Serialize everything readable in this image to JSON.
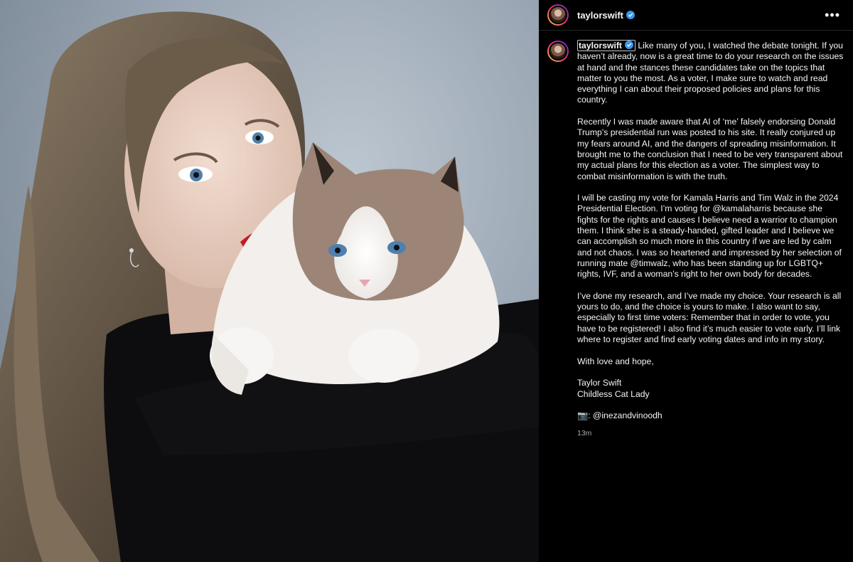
{
  "post": {
    "header": {
      "username": "taylorswift",
      "verified_color": "#3897f0",
      "avatar_icon": "profile-avatar-icon",
      "more_icon": "more-options-icon"
    },
    "caption": {
      "username": "taylorswift",
      "paragraphs": [
        "Like many of you, I watched the debate tonight. If you haven’t already, now is a great time to do your research on the issues at hand and the stances these candidates take on the topics that matter to you the most. As a voter, I make sure to watch and read everything I can about their proposed policies and plans for this country.",
        "Recently I was made aware that AI of ‘me’ falsely endorsing Donald Trump’s presidential run was posted to his site. It really conjured up my fears around AI, and the dangers of spreading misinformation. It brought me to the conclusion that I need to be very transparent about my actual plans for this election as a voter. The simplest way to combat misinformation is with the truth.",
        "I will be casting my vote for Kamala Harris and Tim Walz in the 2024 Presidential Election. I’m voting for @kamalaharris because she fights for the rights and causes I believe need a warrior to champion them. I think she is a steady-handed, gifted leader and I believe we can accomplish so much more in this country if we are led by calm and not chaos. I was so heartened and impressed by her selection of running mate @timwalz, who has been standing up for LGBTQ+ rights, IVF, and a woman’s right to her own body for decades.",
        "I’ve done my research, and I’ve made my choice. Your research is all yours to do, and the choice is yours to make. I also want to say, especially to first time voters: Remember that in order to vote, you have to be registered! I also find it’s much easier to vote early. I’ll link where to register and find early voting dates and info in my story.",
        "With love and hope,"
      ],
      "signature_name": "Taylor Swift",
      "signature_title": "Childless Cat Lady",
      "photo_credit": "📷: @inezandvinoodh"
    },
    "timestamp": "13m"
  }
}
